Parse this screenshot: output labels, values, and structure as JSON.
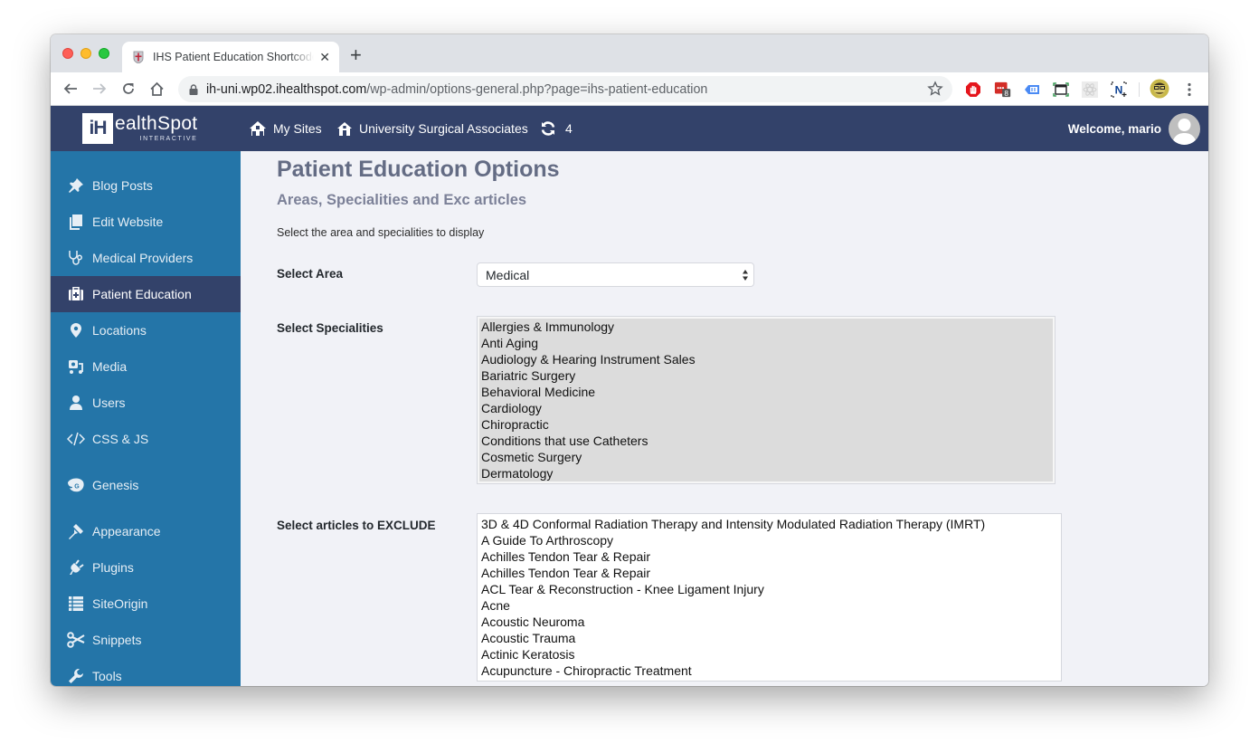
{
  "browser": {
    "tab_title": "IHS Patient Education Shortcode",
    "tab_close_icon": "close-icon",
    "new_tab_icon": "plus-icon",
    "url_domain": "ih-uni.wp02.ihealthspot.com",
    "url_path": "/wp-admin/options-general.php?page=ihs-patient-education",
    "extensions": [
      {
        "name": "adblock-icon"
      },
      {
        "name": "lastpass-icon",
        "badge": "8"
      },
      {
        "name": "tag-extension-icon"
      },
      {
        "name": "screenshot-icon"
      },
      {
        "name": "react-devtools-icon"
      },
      {
        "name": "notion-clipper-icon"
      }
    ]
  },
  "adminbar": {
    "brand_box": "iH",
    "brand_name": "ealthSpot",
    "brand_sub": "INTERACTIVE",
    "my_sites": "My Sites",
    "site_name": "University Surgical Associates",
    "updates_count": "4",
    "welcome": "Welcome, mario"
  },
  "sidebar": {
    "items": [
      {
        "label": "Blog Posts",
        "icon": "pin-icon"
      },
      {
        "label": "Edit Website",
        "icon": "pages-icon"
      },
      {
        "label": "Medical Providers",
        "icon": "stethoscope-icon"
      },
      {
        "label": "Patient Education",
        "icon": "medical-kit-icon",
        "active": true
      },
      {
        "label": "Locations",
        "icon": "location-pin-icon"
      },
      {
        "label": "Media",
        "icon": "media-icon"
      },
      {
        "label": "Users",
        "icon": "user-icon"
      },
      {
        "label": "CSS & JS",
        "icon": "code-icon"
      },
      {
        "label": "Genesis",
        "icon": "genesis-icon"
      },
      {
        "label": "Appearance",
        "icon": "paintbrush-icon"
      },
      {
        "label": "Plugins",
        "icon": "plug-icon"
      },
      {
        "label": "SiteOrigin",
        "icon": "list-table-icon"
      },
      {
        "label": "Snippets",
        "icon": "scissors-icon"
      },
      {
        "label": "Tools",
        "icon": "wrench-icon"
      }
    ]
  },
  "main": {
    "title": "Patient Education Options",
    "subtitle": "Areas, Specialities and Exc articles",
    "description": "Select the area and specialities to display",
    "area_label": "Select Area",
    "area_value": "Medical",
    "specialities_label": "Select Specialities",
    "specialities": [
      "Allergies & Immunology",
      "Anti Aging",
      "Audiology & Hearing Instrument Sales",
      "Bariatric Surgery",
      "Behavioral Medicine",
      "Cardiology",
      "Chiropractic",
      "Conditions that use Catheters",
      "Cosmetic Surgery",
      "Dermatology"
    ],
    "exclude_label": "Select articles to EXCLUDE",
    "exclude_articles": [
      "3D & 4D Conformal Radiation Therapy and Intensity Modulated Radiation Therapy (IMRT)",
      "A Guide To Arthroscopy",
      "Achilles Tendon Tear & Repair",
      "Achilles Tendon Tear & Repair",
      "ACL Tear & Reconstruction - Knee Ligament Injury",
      "Acne",
      "Acoustic Neuroma",
      "Acoustic Trauma",
      "Actinic Keratosis",
      "Acupuncture - Chiropractic Treatment"
    ]
  }
}
